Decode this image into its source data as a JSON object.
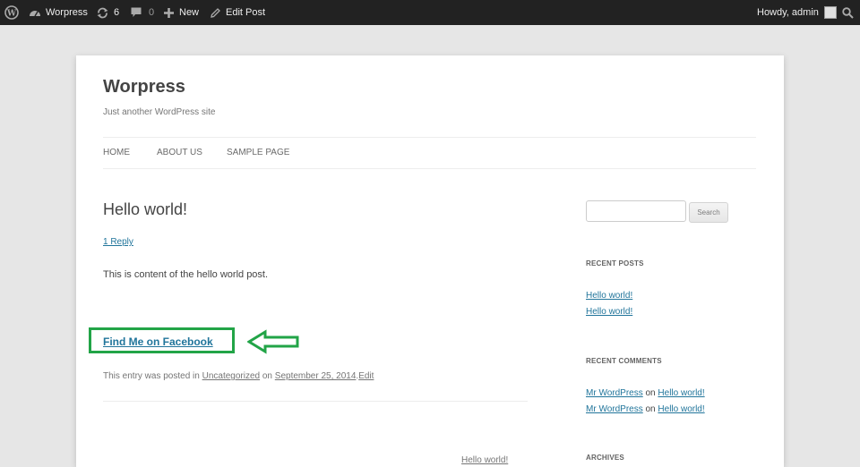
{
  "adminbar": {
    "site_name": "Worpress",
    "updates_count": "6",
    "comments_count": "0",
    "new_label": "New",
    "edit_label": "Edit Post",
    "greeting": "Howdy, admin"
  },
  "header": {
    "site_title": "Worpress",
    "tagline": "Just another WordPress site"
  },
  "nav": {
    "items": [
      {
        "label": "HOME"
      },
      {
        "label": "ABOUT US"
      },
      {
        "label": "SAMPLE PAGE"
      }
    ]
  },
  "post": {
    "title": "Hello world!",
    "reply_link": "1 Reply",
    "content": "This is content of the hello world post.",
    "facebook_link": "Find Me on Facebook",
    "meta_prefix": "This entry was posted in",
    "category": "Uncategorized",
    "meta_on": "on",
    "date": "September 25, 2014",
    "meta_sep": ".",
    "edit_link": "Edit",
    "next_post_partial": "Hello world!"
  },
  "sidebar": {
    "search_button": "Search",
    "recent_posts_title": "RECENT POSTS",
    "recent_posts": [
      "Hello world!",
      "Hello world!"
    ],
    "recent_comments_title": "RECENT COMMENTS",
    "recent_comments": [
      {
        "author": "Mr WordPress",
        "on": "on",
        "post": "Hello world!"
      },
      {
        "author": "Mr WordPress",
        "on": "on",
        "post": "Hello world!"
      }
    ],
    "archives_title": "ARCHIVES"
  },
  "colors": {
    "highlight_green": "#22a447",
    "link_blue": "#21759b",
    "adminbar_bg": "#222222"
  }
}
